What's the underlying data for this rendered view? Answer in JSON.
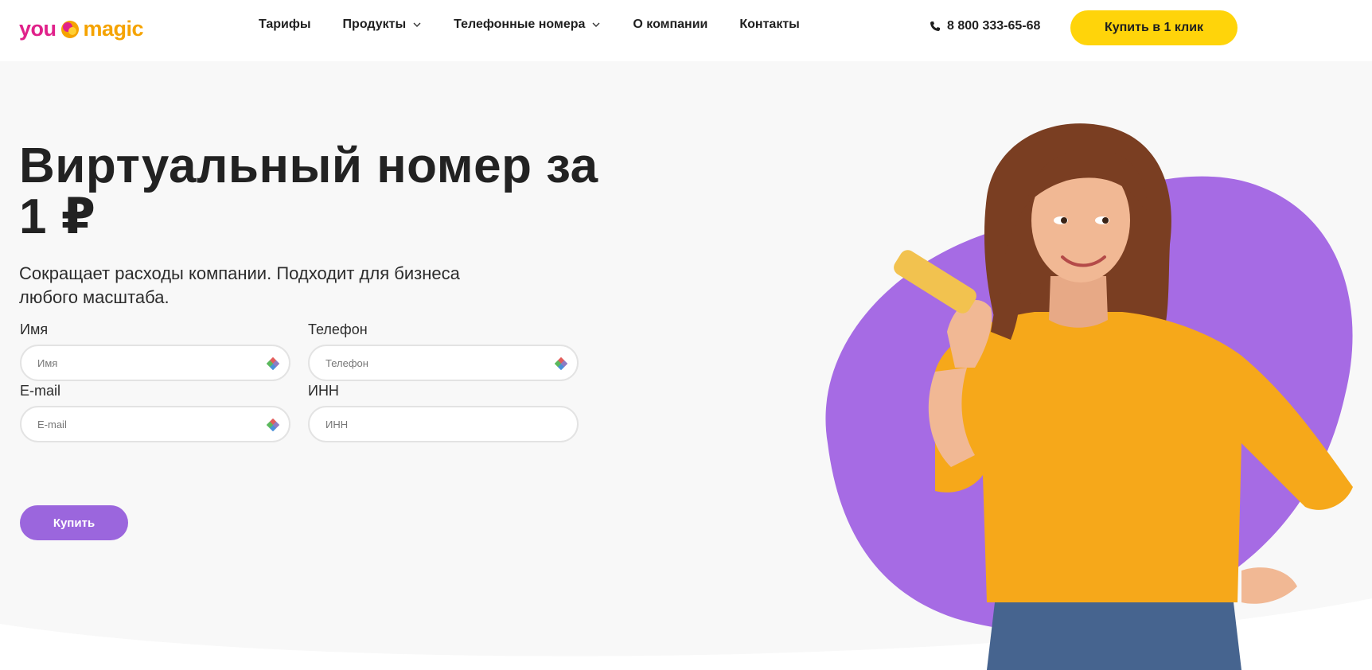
{
  "brand": {
    "logo_part1": "you",
    "logo_part2": "magic",
    "colors": {
      "pink": "#e0218a",
      "orange": "#f5a300",
      "purple": "#9b66dd",
      "yellow": "#ffd40a",
      "blob": "#a66be4"
    }
  },
  "nav": {
    "items": [
      {
        "label": "Тарифы",
        "has_dropdown": false
      },
      {
        "label": "Продукты",
        "has_dropdown": true
      },
      {
        "label": "Телефонные номера",
        "has_dropdown": true
      },
      {
        "label": "О компании",
        "has_dropdown": false
      },
      {
        "label": "Контакты",
        "has_dropdown": false
      }
    ],
    "phone": "8 800 333-65-68",
    "phone_icon": "phone-icon",
    "cta_label": "Купить в 1 клик"
  },
  "hero": {
    "title_line1": "Виртуальный номер за",
    "title_line2": "1 ₽",
    "subtitle_line1": "Сокращает расходы компании. Подходит для бизнеса",
    "subtitle_line2": "любого масштаба.",
    "form": {
      "name_label": "Имя",
      "name_placeholder": "Имя",
      "phone_label": "Телефон",
      "phone_placeholder": "Телефон",
      "email_label": "E-mail",
      "email_placeholder": "E-mail",
      "inn_label": "ИНН",
      "inn_placeholder": "ИНН",
      "submit_label": "Купить"
    }
  }
}
